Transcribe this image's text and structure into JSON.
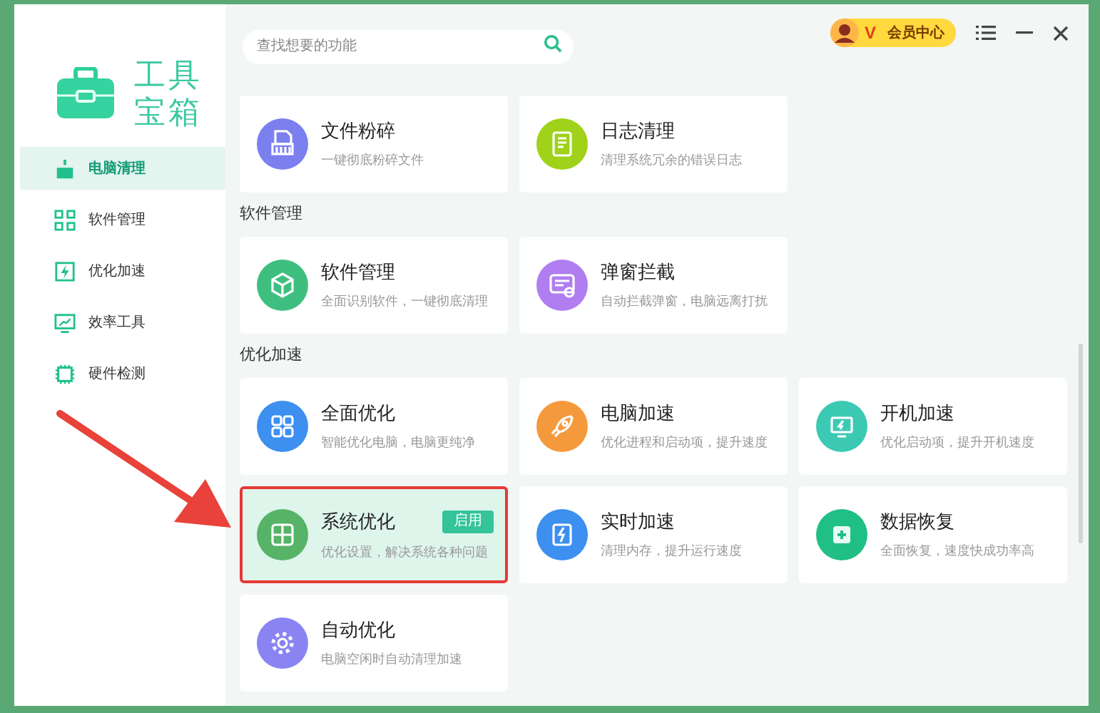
{
  "logo": {
    "title": "工具宝箱"
  },
  "sidebar": {
    "items": [
      {
        "label": "电脑清理",
        "selected": true
      },
      {
        "label": "软件管理",
        "selected": false
      },
      {
        "label": "优化加速",
        "selected": false
      },
      {
        "label": "效率工具",
        "selected": false
      },
      {
        "label": "硬件检测",
        "selected": false
      }
    ]
  },
  "search": {
    "placeholder": "查找想要的功能"
  },
  "vip": {
    "label": "会员中心",
    "mark": "V"
  },
  "sections": [
    {
      "cards": [
        {
          "title": "文件粉碎",
          "subtitle": "一键彻底粉碎文件",
          "color": "#7b7ff0",
          "highlighted": false
        },
        {
          "title": "日志清理",
          "subtitle": "清理系统冗余的错误日志",
          "color": "#9fd219",
          "highlighted": false
        }
      ]
    },
    {
      "title": "软件管理",
      "cards": [
        {
          "title": "软件管理",
          "subtitle": "全面识别软件，一键彻底清理",
          "color": "#3fbf7f",
          "highlighted": false
        },
        {
          "title": "弹窗拦截",
          "subtitle": "自动拦截弹窗，电脑远离打扰",
          "color": "#b07ef0",
          "highlighted": false
        }
      ]
    },
    {
      "title": "优化加速",
      "cards": [
        {
          "title": "全面优化",
          "subtitle": "智能优化电脑，电脑更纯净",
          "color": "#3d8ff0",
          "highlighted": false
        },
        {
          "title": "电脑加速",
          "subtitle": "优化进程和启动项，提升速度",
          "color": "#f59a3c",
          "highlighted": false
        },
        {
          "title": "开机加速",
          "subtitle": "优化启动项，提升开机速度",
          "color": "#3cc9b4",
          "highlighted": false
        },
        {
          "title": "系统优化",
          "subtitle": "优化设置，解决系统各种问题",
          "color": "#56b368",
          "highlighted": true,
          "badge": "启用"
        },
        {
          "title": "实时加速",
          "subtitle": "清理内存，提升运行速度",
          "color": "#3d8ff0",
          "highlighted": false
        },
        {
          "title": "数据恢复",
          "subtitle": "全面恢复，速度快成功率高",
          "color": "#1fbf86",
          "highlighted": false
        },
        {
          "title": "自动优化",
          "subtitle": "电脑空闲时自动清理加速",
          "color": "#8a84f2",
          "highlighted": false
        }
      ]
    }
  ]
}
